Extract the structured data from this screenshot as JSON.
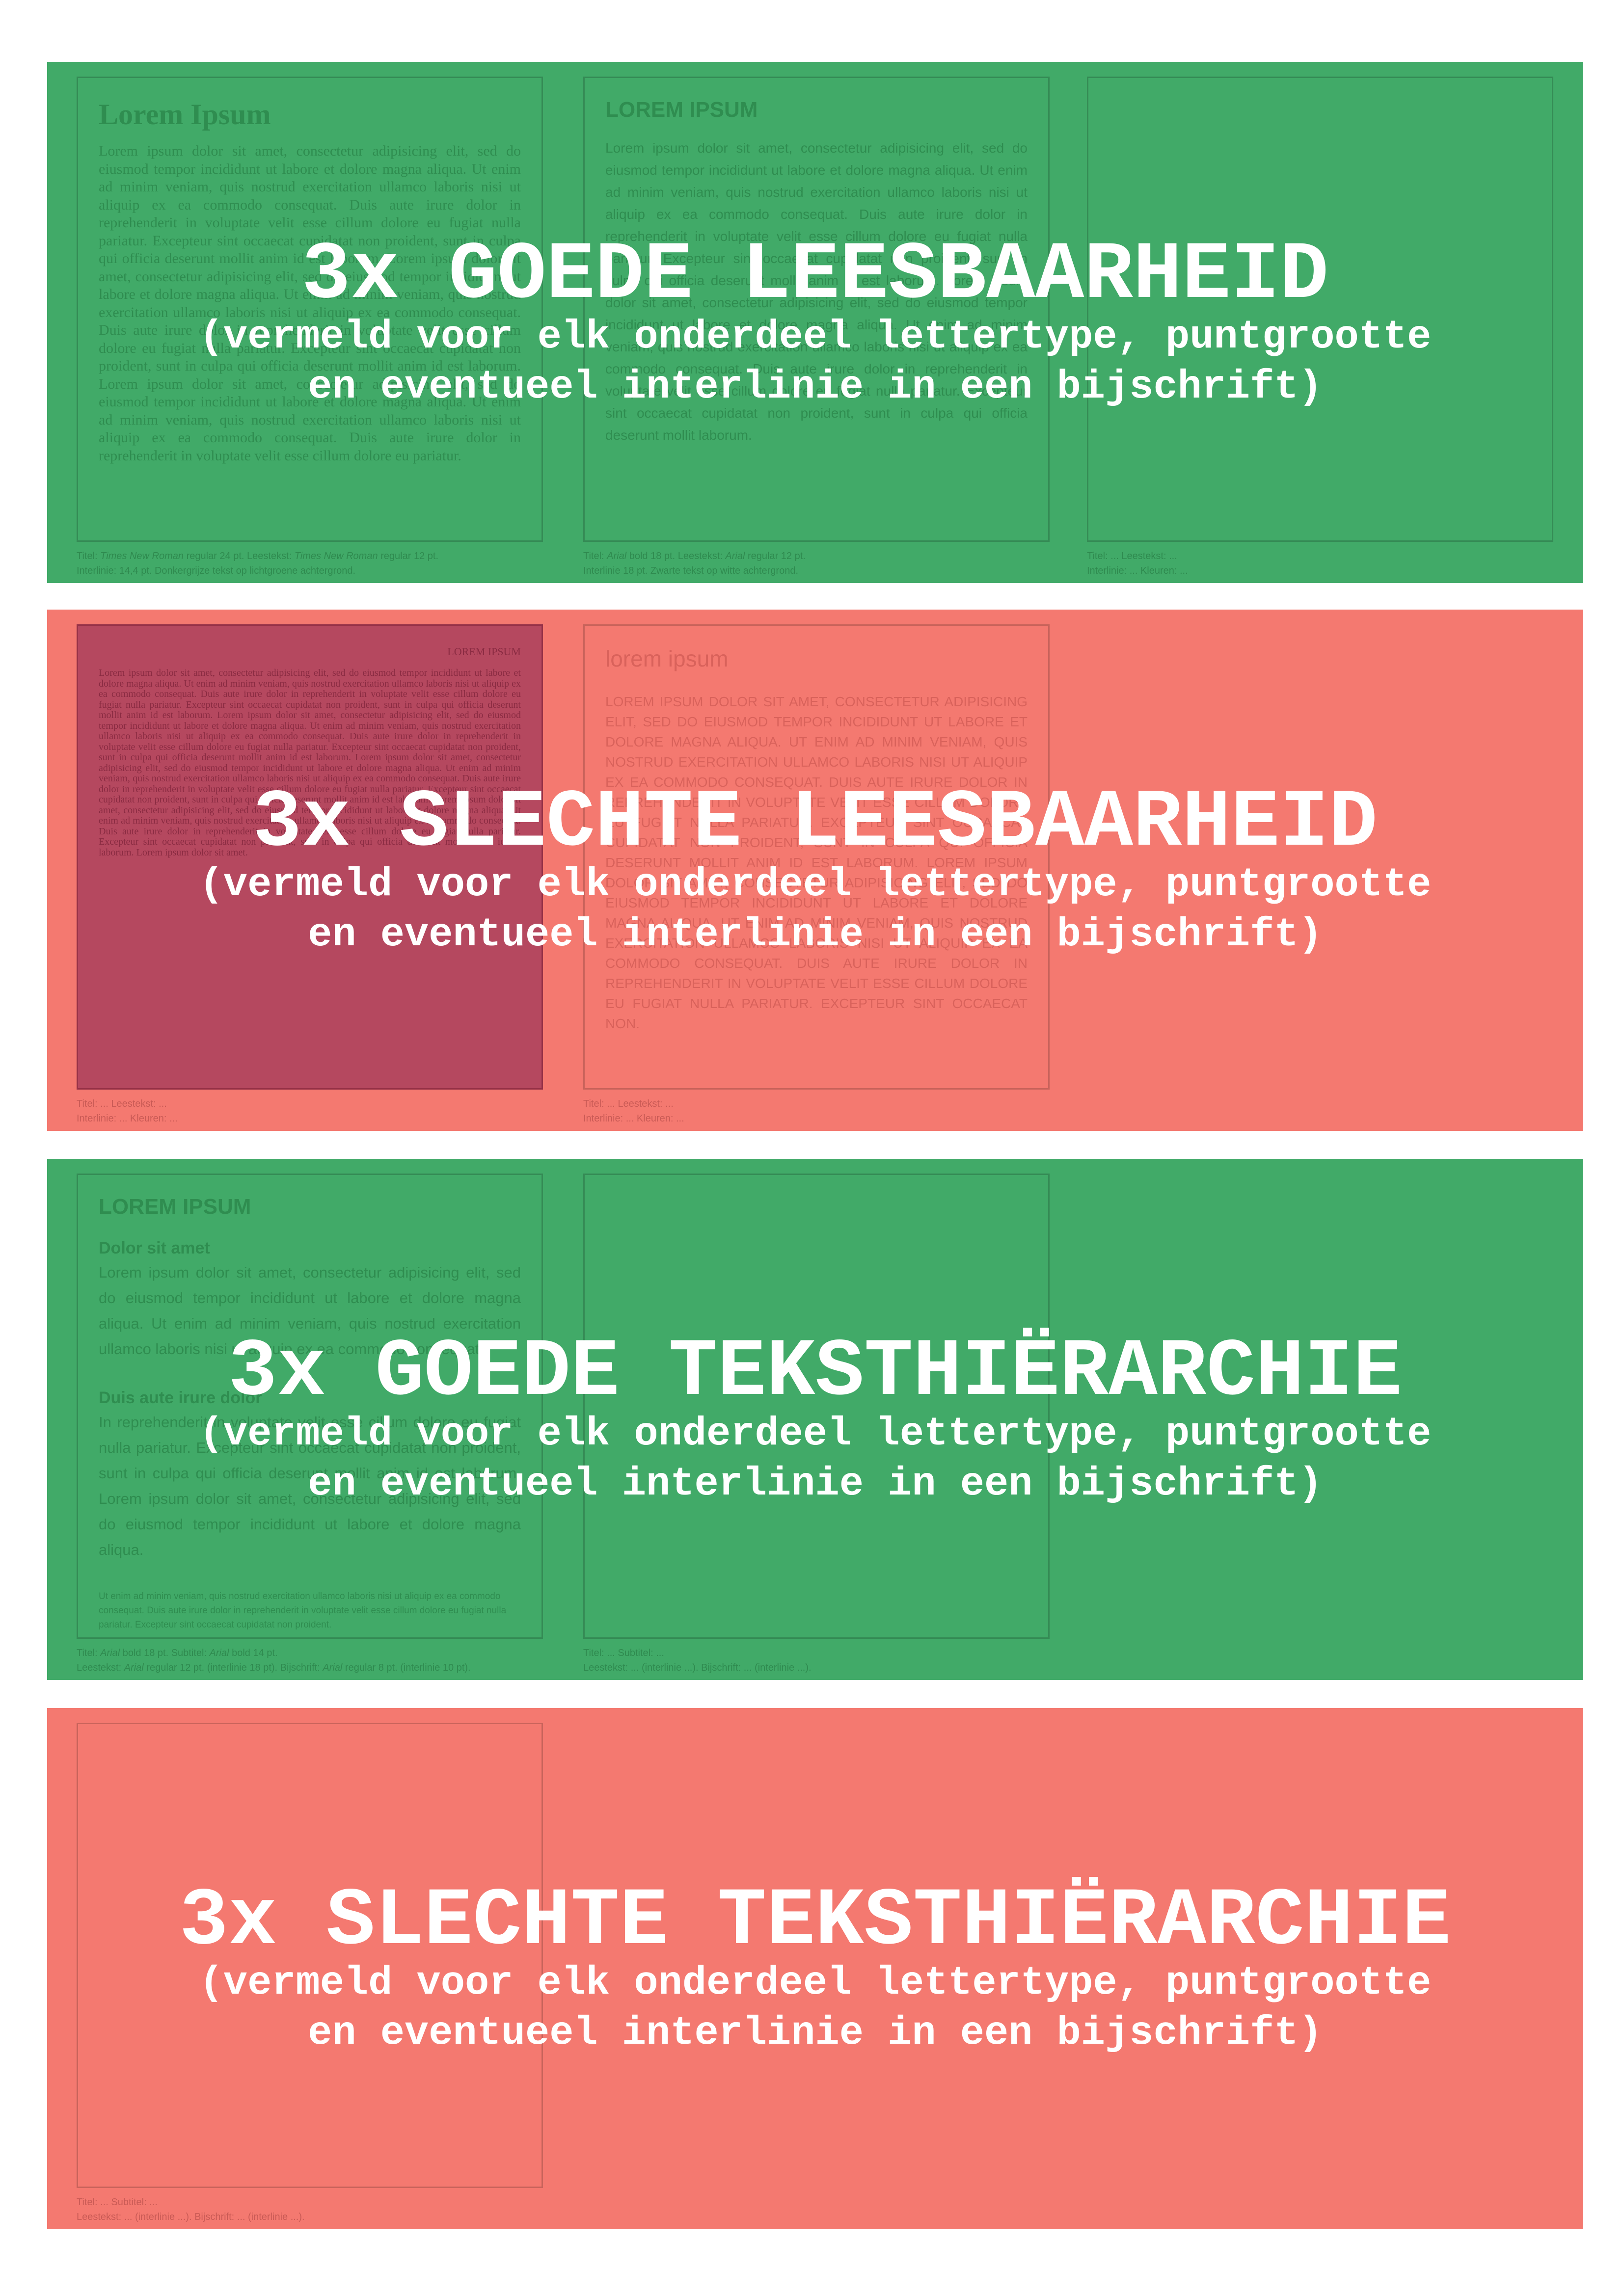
{
  "colors": {
    "good": "#41aa68",
    "bad": "#f47970",
    "overlay_text": "#ffffff"
  },
  "subtitle_line1": "(vermeld voor elk onderdeel lettertype, puntgrootte",
  "subtitle_line2": "en eventueel interlinie in een bijschrift)",
  "sections": [
    {
      "title": "3x GOEDE LEESBAARHEID",
      "panels": [
        {
          "title": "Lorem Ipsum",
          "body": "Lorem ipsum dolor sit amet, consectetur adipisicing elit, sed do eiusmod tempor incididunt ut labore et dolore magna aliqua. Ut enim ad minim veniam, quis nostrud exercitation ullamco laboris nisi ut aliquip ex ea commodo consequat. Duis aute irure dolor in reprehenderit in voluptate velit esse cillum dolore eu fugiat nulla pariatur. Excepteur sint occaecat cupidatat non proident, sunt in culpa qui officia deserunt mollit anim id est laborum. Lorem ipsum dolor sit amet, consectetur adipisicing elit, sed do eiusmod tempor incididunt ut labore et dolore magna aliqua. Ut enim ad minim veniam, quis nostrud exercitation ullamco laboris nisi ut aliquip ex ea commodo consequat. Duis aute irure dolor in reprehenderit in voluptate velit esse cillum dolore eu fugiat nulla pariatur. Excepteur sint occaecat cupidatat non proident, sunt in culpa qui officia deserunt mollit anim id est laborum. Lorem ipsum dolor sit amet, consectetur adipisicing elit, sed do eiusmod tempor incididunt ut labore et dolore magna aliqua. Ut enim ad minim veniam, quis nostrud exercitation ullamco laboris nisi ut aliquip ex ea commodo consequat. Duis aute irure dolor in reprehenderit in voluptate velit esse cillum dolore eu pariatur."
        },
        {
          "title": "LOREM IPSUM",
          "body": "Lorem ipsum dolor sit amet, consectetur adipisicing elit, sed do eiusmod tempor incididunt ut labore et dolore magna aliqua. Ut enim ad minim veniam, quis nostrud exercitation ullamco laboris nisi ut aliquip ex ea commodo consequat. Duis aute irure dolor in reprehenderit in voluptate velit esse cillum dolore eu fugiat nulla pariatur. Excepteur sint occaecat cupidatat non proident, sunt in culpa qui officia deserunt mollit anim id est laborum. Lorem ipsum dolor sit amet, consectetur adipisicing elit, sed do eiusmod tempor incididunt ut labore et dolore magna aliqua. Ut enim ad minim veniam, quis nostrud exercitation ullamco laboris nisi ut aliquip ex ea commodo consequat. Duis aute irure dolor in reprehenderit in voluptate velit esse cillum dolore eu fugiat nulla pariatur. Excepteur sint occaecat cupidatat non proident, sunt in culpa qui officia deserunt mollit laborum."
        }
      ],
      "captions": [
        {
          "l1a": "Titel: ",
          "l1b": "Times New Roman",
          "l1c": " regular 24 pt. Leestekst: ",
          "l1d": "Times New Roman",
          "l1e": " regular 12 pt.",
          "l2": "Interlinie: 14,4 pt. Donkergrijze tekst op lichtgroene achtergrond."
        },
        {
          "l1a": "Titel: ",
          "l1b": "Arial",
          "l1c": " bold 18 pt. Leestekst: ",
          "l1d": "Arial",
          "l1e": " regular 12 pt.",
          "l2": "Interlinie 18 pt. Zwarte tekst op witte achtergrond."
        },
        {
          "l1": "Titel: ... Leestekst: ...",
          "l2": "Interlinie: ... Kleuren: ..."
        }
      ]
    },
    {
      "title": "3x SLECHTE LEESBAARHEID",
      "panels": [
        {
          "title": "LOREM IPSUM",
          "body": "Lorem ipsum dolor sit amet, consectetur adipisicing elit, sed do eiusmod tempor incididunt ut labore et dolore magna aliqua. Ut enim ad minim veniam, quis nostrud exercitation ullamco laboris nisi ut aliquip ex ea commodo consequat. Duis aute irure dolor in reprehenderit in voluptate velit esse cillum dolore eu fugiat nulla pariatur. Excepteur sint occaecat cupidatat non proident, sunt in culpa qui officia deserunt mollit anim id est laborum. Lorem ipsum dolor sit amet, consectetur adipisicing elit, sed do eiusmod tempor incididunt ut labore et dolore magna aliqua. Ut enim ad minim veniam, quis nostrud exercitation ullamco laboris nisi ut aliquip ex ea commodo consequat. Duis aute irure dolor in reprehenderit in voluptate velit esse cillum dolore eu fugiat nulla pariatur. Excepteur sint occaecat cupidatat non proident, sunt in culpa qui officia deserunt mollit anim id est laborum. Lorem ipsum dolor sit amet, consectetur adipisicing elit, sed do eiusmod tempor incididunt ut labore et dolore magna aliqua. Ut enim ad minim veniam, quis nostrud exercitation ullamco laboris nisi ut aliquip ex ea commodo consequat. Duis aute irure dolor in reprehenderit in voluptate velit esse cillum dolore eu fugiat nulla pariatur. Excepteur sint occaecat cupidatat non proident, sunt in culpa qui officia deserunt mollit anim id est laborum. Lorem ipsum dolor sit amet, consectetur adipisicing elit, sed do eiusmod tempor incididunt ut labore et dolore magna aliqua. Ut enim ad minim veniam, quis nostrud exercitation ullamco laboris nisi ut aliquip ex ea commodo consequat. Duis aute irure dolor in reprehenderit in voluptate velit esse cillum dolore eu fugiat nulla pariatur. Excepteur sint occaecat cupidatat non proident, sunt in culpa qui officia deserunt mollit anim id est laborum. Lorem ipsum dolor sit amet."
        },
        {
          "title": "lorem ipsum",
          "body": "Lorem ipsum dolor sit amet, consectetur adipisicing elit, sed do eiusmod tempor incididunt ut labore et dolore magna aliqua. Ut enim ad minim veniam, quis nostrud exercitation ullamco laboris nisi ut aliquip ex ea commodo consequat. Duis aute irure dolor in reprehenderit in voluptate velit esse cillum dolore eu fugiat nulla pariatur. Excepteur sint occaecat cupidatat non proident, sunt in culpa qui officia deserunt mollit anim id est laborum. Lorem ipsum dolor sit amet, consectetur adipisicing elit, sed do eiusmod tempor incididunt ut labore et dolore magna aliqua. Ut enim ad minim veniam, quis nostrud exercitation ullamco laboris nisi ut aliquip ex ea commodo consequat. Duis aute irure dolor in reprehenderit in voluptate velit esse cillum dolore eu fugiat nulla pariatur. Excepteur sint occaecat non."
        }
      ],
      "captions": [
        {
          "l1": "Titel: ... Leestekst: ...",
          "l2": "Interlinie: ... Kleuren: ..."
        },
        {
          "l1": "Titel: ... Leestekst: ...",
          "l2": "Interlinie: ... Kleuren: ..."
        }
      ]
    },
    {
      "title": "3x GOEDE TEKSTHIËRARCHIE",
      "panels": [
        {
          "title": "LOREM IPSUM",
          "sub1": "Dolor sit amet",
          "body1": "Lorem ipsum dolor sit amet, consectetur adipisicing elit, sed do eiusmod tempor incididunt ut labore et dolore magna aliqua. Ut enim ad minim veniam, quis nostrud exercitation ullamco laboris nisi ut aliquip ex ea commodo consequat.",
          "sub2": "Duis aute irure dolor",
          "body2": "In reprehenderit in voluptate velit esse cillum dolore eu fugiat nulla pariatur. Excepteur sint occaecat cupidatat non proident, sunt in culpa qui officia deserunt mollit anim id est laborum. Lorem ipsum dolor sit amet, consectetur adipisicing elit, sed do eiusmod tempor incididunt ut labore et dolore magna aliqua.",
          "caption": "Ut enim ad minim veniam, quis nostrud exercitation ullamco laboris nisi ut aliquip ex ea commodo consequat. Duis aute irure dolor in reprehenderit in voluptate velit esse cillum dolore eu fugiat nulla pariatur. Excepteur sint occaecat cupidatat non proident."
        }
      ],
      "captions": [
        {
          "l1a": "Titel: ",
          "l1b": "Arial",
          "l1c": " bold 18 pt. Subtitel: ",
          "l1d": "Arial",
          "l1e": " bold 14 pt.",
          "l2a": "Leestekst: ",
          "l2b": "Arial",
          "l2c": " regular 12 pt. (interlinie 18 pt). Bijschrift: ",
          "l2d": "Arial",
          "l2e": " regular 8 pt. (interlinie 10 pt)."
        },
        {
          "l1": "Titel: ... Subtitel: ...",
          "l2": "Leestekst: ... (interlinie ...). Bijschrift: ... (interlinie ...)."
        }
      ]
    },
    {
      "title": "3x SLECHTE TEKSTHIËRARCHIE",
      "captions": [
        {
          "l1": "Titel: ... Subtitel: ...",
          "l2": "Leestekst: ... (interlinie ...). Bijschrift: ... (interlinie ...)."
        }
      ]
    }
  ]
}
